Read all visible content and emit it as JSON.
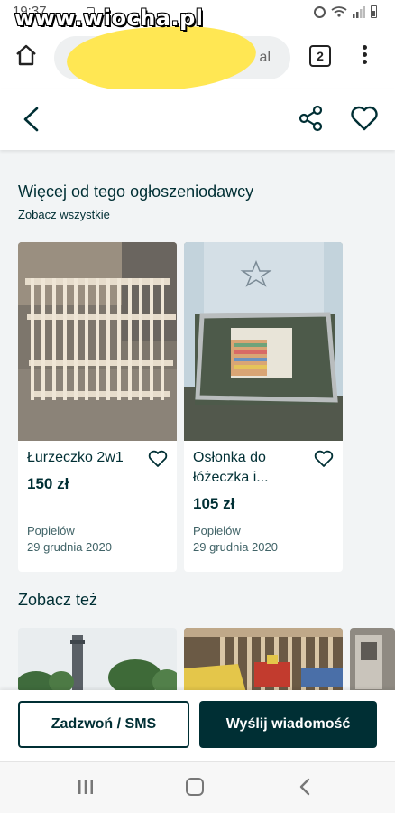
{
  "status_bar": {
    "time": "19:37",
    "watermark": "www.wiocha.pl",
    "icons": [
      "alarm-icon",
      "wifi-icon",
      "signal-icon",
      "battery-icon"
    ]
  },
  "browser": {
    "url_tail": "al",
    "tab_count": "2",
    "icons": [
      "home-icon",
      "more-vert-icon"
    ]
  },
  "header": {
    "icons": [
      "back-arrow-icon",
      "share-icon",
      "heart-icon"
    ]
  },
  "more_from_seller": {
    "title": "Więcej od tego ogłoszeniodawcy",
    "see_all": "Zobacz wszystkie",
    "items": [
      {
        "title": "Łurzeczko 2w1",
        "price": "150 zł",
        "location": "Popielów",
        "date": "29 grudnia 2020"
      },
      {
        "title": "Osłonka do łóżeczka i...",
        "price": "105 zł",
        "location": "Popielów",
        "date": "29 grudnia 2020"
      }
    ]
  },
  "see_also": {
    "title": "Zobacz też"
  },
  "actions": {
    "call_label": "Zadzwoń / SMS",
    "message_label": "Wyślij wiadomość"
  },
  "nav_bar": {
    "icons": [
      "recent-apps-icon",
      "home-nav-icon",
      "back-nav-icon"
    ]
  },
  "colors": {
    "brand_dark": "#002f34",
    "background": "#f2f4f5",
    "highlight": "#ffe64a"
  }
}
